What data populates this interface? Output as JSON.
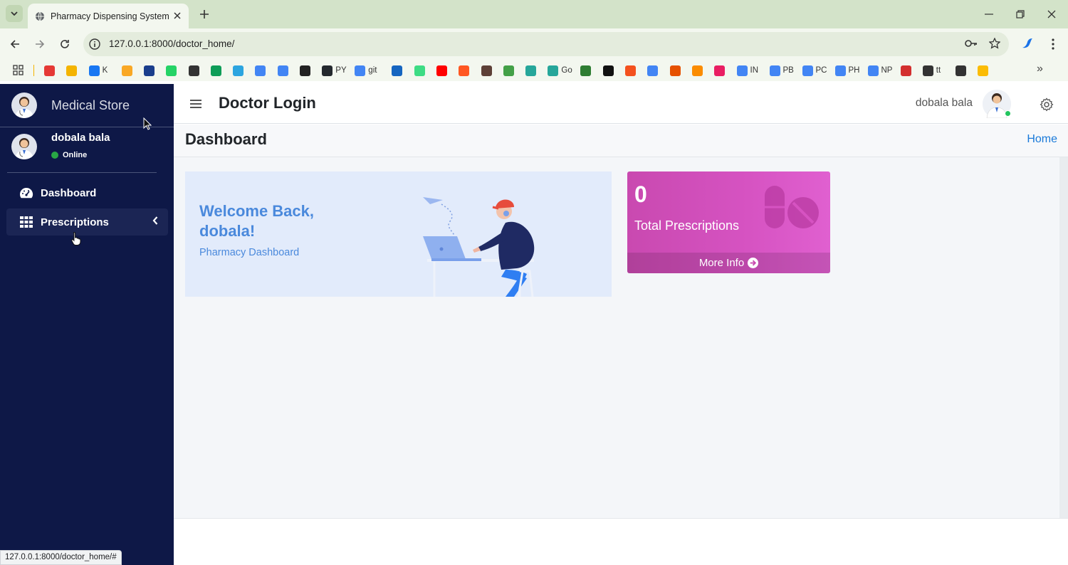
{
  "browser": {
    "tab_title": "Pharmacy Dispensing System",
    "url": "127.0.0.1:8000/doctor_home/",
    "status_url": "127.0.0.1:8000/doctor_home/#"
  },
  "bookmarks": [
    {
      "label": "",
      "color": "#e53935"
    },
    {
      "label": "",
      "color": "#f4b400"
    },
    {
      "label": "K",
      "color": "#1877f2"
    },
    {
      "label": "",
      "color": "#f9a825"
    },
    {
      "label": "",
      "color": "#1a3e8c"
    },
    {
      "label": "",
      "color": "#25d366"
    },
    {
      "label": "",
      "color": "#333333"
    },
    {
      "label": "",
      "color": "#0f9d58"
    },
    {
      "label": "",
      "color": "#2ca5e0"
    },
    {
      "label": "",
      "color": "#4285f4"
    },
    {
      "label": "",
      "color": "#4285f4"
    },
    {
      "label": "",
      "color": "#222222"
    },
    {
      "label": "PY",
      "color": "#24292e"
    },
    {
      "label": "git",
      "color": "#4285f4"
    },
    {
      "label": "",
      "color": "#1565c0"
    },
    {
      "label": "",
      "color": "#3ddc84"
    },
    {
      "label": "",
      "color": "#ff0000"
    },
    {
      "label": "",
      "color": "#ff5722"
    },
    {
      "label": "",
      "color": "#5d4037"
    },
    {
      "label": "",
      "color": "#43a047"
    },
    {
      "label": "",
      "color": "#26a69a"
    },
    {
      "label": "Go",
      "color": "#26a69a"
    },
    {
      "label": "",
      "color": "#2e7d32"
    },
    {
      "label": "",
      "color": "#111111"
    },
    {
      "label": "",
      "color": "#f4511e"
    },
    {
      "label": "",
      "color": "#4285f4"
    },
    {
      "label": "",
      "color": "#e65100"
    },
    {
      "label": "",
      "color": "#fb8c00"
    },
    {
      "label": "",
      "color": "#e91e63"
    },
    {
      "label": "IN",
      "color": "#4285f4"
    },
    {
      "label": "PB",
      "color": "#4285f4"
    },
    {
      "label": "PC",
      "color": "#4285f4"
    },
    {
      "label": "PH",
      "color": "#4285f4"
    },
    {
      "label": "NP",
      "color": "#4285f4"
    },
    {
      "label": "",
      "color": "#d32f2f"
    },
    {
      "label": "tt",
      "color": "#333333"
    },
    {
      "label": "",
      "color": "#333333"
    },
    {
      "label": "",
      "color": "#fbbc05"
    }
  ],
  "sidebar": {
    "brand": "Medical Store",
    "user_name": "dobala bala",
    "user_status": "Online",
    "items": [
      {
        "label": "Dashboard"
      },
      {
        "label": "Prescriptions"
      }
    ]
  },
  "header": {
    "title": "Doctor Login",
    "user_name": "dobala bala"
  },
  "content": {
    "page_title": "Dashboard",
    "breadcrumb_home": "Home",
    "welcome_line1": "Welcome Back,",
    "welcome_line2": "dobala!",
    "welcome_sub": "Pharmacy Dashboard"
  },
  "card": {
    "count": "0",
    "label": "Total Prescriptions",
    "footer": "More Info",
    "color": "#d653c2"
  }
}
